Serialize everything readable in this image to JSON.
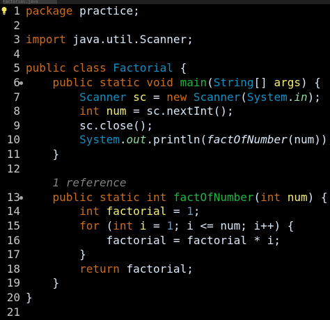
{
  "editor": {
    "tab_title": "Factorial.java",
    "colors": {
      "background": "#000000",
      "line_number": "#c8c8c8",
      "keyword": "#cc6c1d",
      "type": "#1290c3",
      "variable": "#f3ec79",
      "field": "#8dda9a",
      "number": "#6897bb",
      "plain": "#d9e8f7",
      "comment": "#808080"
    }
  },
  "gutter": {
    "lines": [
      {
        "n": "1",
        "marker": "bulb-icon"
      },
      {
        "n": "2"
      },
      {
        "n": "3"
      },
      {
        "n": "4"
      },
      {
        "n": "5"
      },
      {
        "n": "6",
        "marker": "fold"
      },
      {
        "n": "7"
      },
      {
        "n": "8"
      },
      {
        "n": "9"
      },
      {
        "n": "10"
      },
      {
        "n": "11"
      },
      {
        "n": "12"
      },
      {
        "n": ""
      },
      {
        "n": "13",
        "marker": "fold"
      },
      {
        "n": "14"
      },
      {
        "n": "15"
      },
      {
        "n": "16"
      },
      {
        "n": "17"
      },
      {
        "n": "18"
      },
      {
        "n": "19"
      },
      {
        "n": "20"
      },
      {
        "n": "21"
      }
    ]
  },
  "code": {
    "lines": [
      [
        {
          "t": "package",
          "c": "kw"
        },
        {
          "t": " practice;",
          "c": "plain"
        }
      ],
      [],
      [
        {
          "t": "import",
          "c": "kw"
        },
        {
          "t": " java.util.Scanner;",
          "c": "plain"
        }
      ],
      [],
      [
        {
          "t": "public class ",
          "c": "kw"
        },
        {
          "t": "Factorial",
          "c": "type"
        },
        {
          "t": " {",
          "c": "plain"
        }
      ],
      [
        {
          "t": "    public static void ",
          "c": "kw"
        },
        {
          "t": "main",
          "c": "method"
        },
        {
          "t": "(",
          "c": "plain"
        },
        {
          "t": "String",
          "c": "type"
        },
        {
          "t": "[] ",
          "c": "plain"
        },
        {
          "t": "args",
          "c": "var"
        },
        {
          "t": ") {",
          "c": "plain"
        }
      ],
      [
        {
          "t": "        Scanner ",
          "c": "type"
        },
        {
          "t": "sc",
          "c": "var"
        },
        {
          "t": " = ",
          "c": "plain"
        },
        {
          "t": "new ",
          "c": "kw"
        },
        {
          "t": "Scanner",
          "c": "type"
        },
        {
          "t": "(",
          "c": "plain"
        },
        {
          "t": "System",
          "c": "type"
        },
        {
          "t": ".",
          "c": "plain"
        },
        {
          "t": "in",
          "c": "field",
          "s": "it"
        },
        {
          "t": ");",
          "c": "plain"
        }
      ],
      [
        {
          "t": "        int ",
          "c": "kw"
        },
        {
          "t": "num",
          "c": "var"
        },
        {
          "t": " = sc.nextInt();",
          "c": "plain"
        }
      ],
      [
        {
          "t": "        sc.close();",
          "c": "plain"
        }
      ],
      [
        {
          "t": "        System",
          "c": "type"
        },
        {
          "t": ".",
          "c": "plain"
        },
        {
          "t": "out",
          "c": "field",
          "s": "it"
        },
        {
          "t": ".println(",
          "c": "plain"
        },
        {
          "t": "factOfNumber",
          "c": "plain",
          "s": "it"
        },
        {
          "t": "(num));",
          "c": "plain"
        }
      ],
      [
        {
          "t": "    }",
          "c": "plain"
        }
      ],
      [],
      [
        {
          "t": "    1 reference",
          "c": "comment"
        }
      ],
      [
        {
          "t": "    public static int ",
          "c": "kw"
        },
        {
          "t": "factOfNumber",
          "c": "method"
        },
        {
          "t": "(",
          "c": "plain"
        },
        {
          "t": "int ",
          "c": "kw"
        },
        {
          "t": "num",
          "c": "var"
        },
        {
          "t": ") {",
          "c": "plain"
        }
      ],
      [
        {
          "t": "        int ",
          "c": "kw"
        },
        {
          "t": "factorial",
          "c": "var"
        },
        {
          "t": " = ",
          "c": "plain"
        },
        {
          "t": "1",
          "c": "num"
        },
        {
          "t": ";",
          "c": "plain"
        }
      ],
      [
        {
          "t": "        for ",
          "c": "kw"
        },
        {
          "t": "(",
          "c": "plain"
        },
        {
          "t": "int ",
          "c": "kw"
        },
        {
          "t": "i",
          "c": "var"
        },
        {
          "t": " = ",
          "c": "plain"
        },
        {
          "t": "1",
          "c": "num"
        },
        {
          "t": "; i <= num; i++) {",
          "c": "plain"
        }
      ],
      [
        {
          "t": "            factorial = factorial * i;",
          "c": "plain"
        }
      ],
      [
        {
          "t": "        }",
          "c": "plain"
        }
      ],
      [
        {
          "t": "        return ",
          "c": "kw"
        },
        {
          "t": "factorial;",
          "c": "plain"
        }
      ],
      [
        {
          "t": "    }",
          "c": "plain"
        }
      ],
      [
        {
          "t": "}",
          "c": "plain"
        }
      ],
      []
    ]
  }
}
